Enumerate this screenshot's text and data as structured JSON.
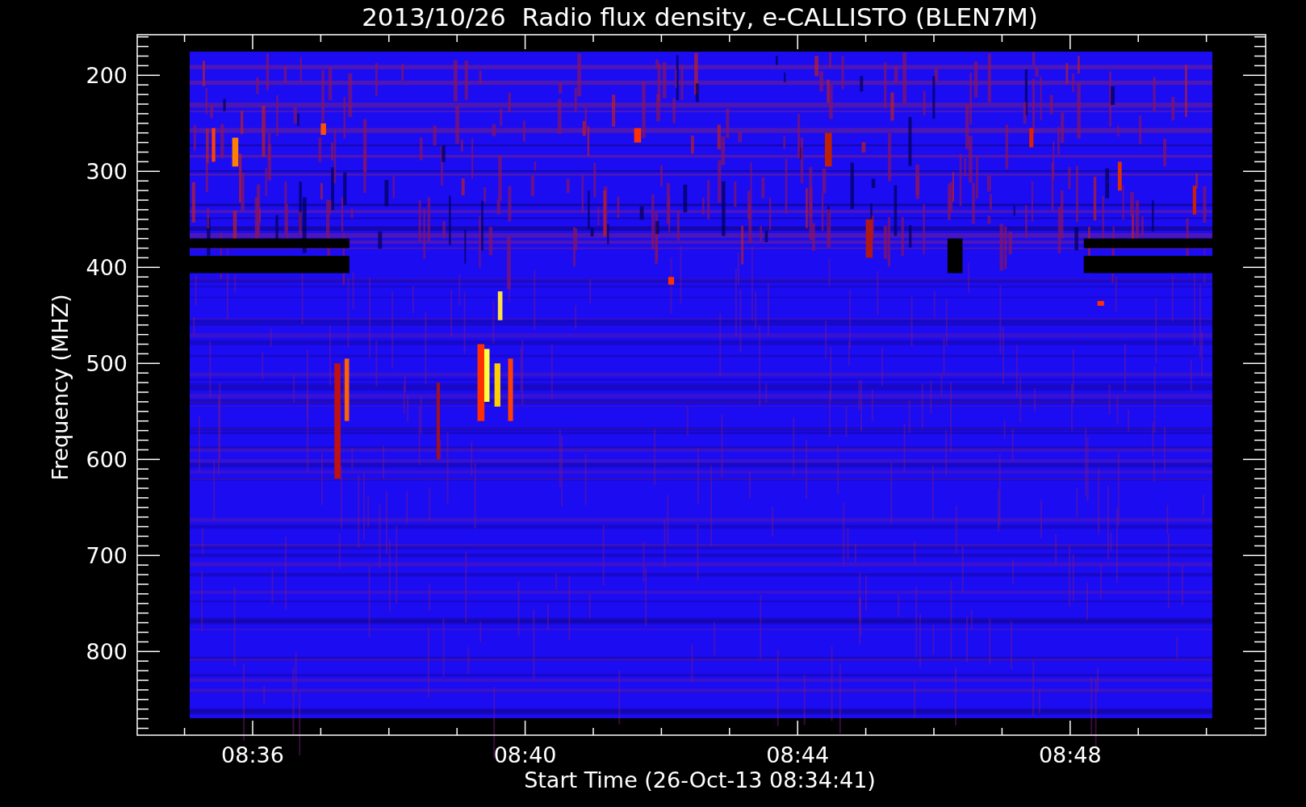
{
  "plot": {
    "title": "2013/10/26  Radio flux density, e-CALLISTO (BLEN7M)",
    "xlabel": "Start Time (26-Oct-13 08:34:41)",
    "ylabel": "Frequency (MHZ)",
    "yticks": [
      "200",
      "300",
      "400",
      "500",
      "600",
      "700",
      "800"
    ],
    "xticks": [
      "08:36",
      "08:40",
      "08:44",
      "08:48"
    ]
  }
}
